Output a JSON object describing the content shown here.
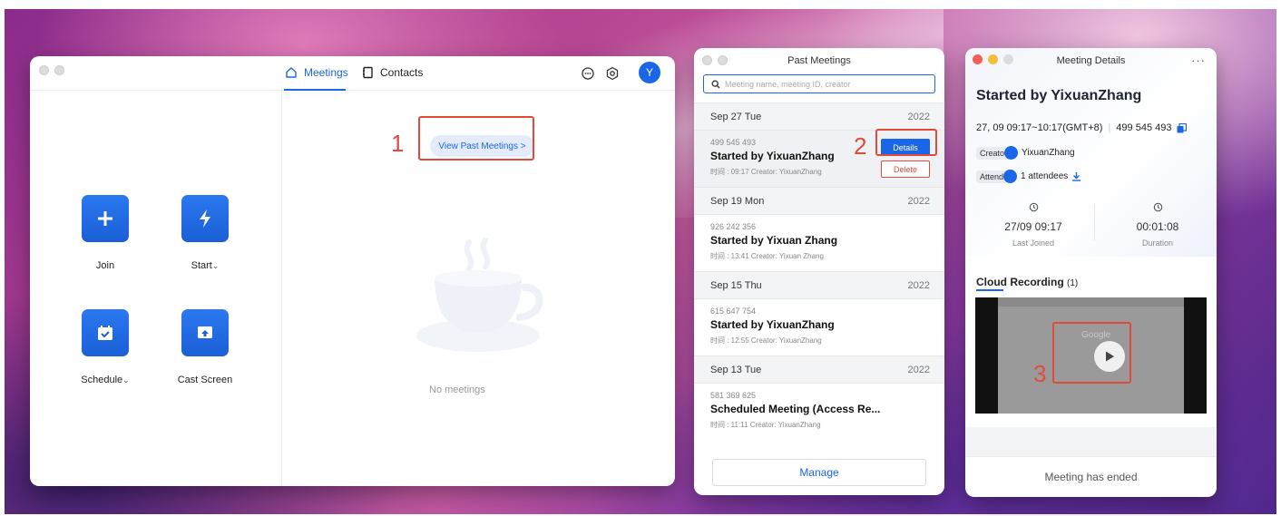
{
  "main_window": {
    "tabs": [
      {
        "label": "Meetings",
        "active": true
      },
      {
        "label": "Contacts",
        "active": false
      }
    ],
    "avatar_letter": "Y",
    "actions": [
      {
        "label": "Join",
        "icon": "plus-icon",
        "caret": false
      },
      {
        "label": "Start",
        "icon": "bolt-icon",
        "caret": true
      },
      {
        "label": "Schedule",
        "icon": "calendar-check-icon",
        "caret": true
      },
      {
        "label": "Cast Screen",
        "icon": "cast-screen-icon",
        "caret": false
      }
    ],
    "caret_glyph": "⌄",
    "view_past_label": "View Past Meetings >",
    "empty_text": "No meetings"
  },
  "annotations": {
    "step1": "1",
    "step2": "2",
    "step3": "3"
  },
  "past_meetings": {
    "title": "Past Meetings",
    "search_placeholder": "Meeting name, meeting ID, creator",
    "groups": [
      {
        "date": "Sep 27 Tue",
        "year": "2022",
        "meeting_id": "499 545 493",
        "title": "Started by YixuanZhang",
        "meta": "时间 : 09:17   Creator: YixuanZhang",
        "selected": true
      },
      {
        "date": "Sep 19 Mon",
        "year": "2022",
        "meeting_id": "926 242 356",
        "title": "Started by Yixuan Zhang",
        "meta": "时间 : 13:41   Creator: Yixuan Zhang",
        "selected": false
      },
      {
        "date": "Sep 15 Thu",
        "year": "2022",
        "meeting_id": "615 647 754",
        "title": "Started by YixuanZhang",
        "meta": "时间 : 12:55   Creator: YixuanZhang",
        "selected": false
      },
      {
        "date": "Sep 13 Tue",
        "year": "2022",
        "meeting_id": "581 369 625",
        "title": "Scheduled Meeting (Access Re...",
        "meta": "时间 : 11:11   Creator: YixuanZhang",
        "selected": false
      }
    ],
    "details_label": "Details",
    "delete_label": "Delete",
    "manage_label": "Manage"
  },
  "meeting_details": {
    "window_title": "Meeting Details",
    "more": "···",
    "title": "Started by YixuanZhang",
    "time_range": "27, 09 09:17~10:17(GMT+8)",
    "meeting_id": "499 545 493",
    "creator_chip": "Creato",
    "creator_name": "YixuanZhang",
    "attendee_chip": "Attend",
    "attendees_text": "1 attendees",
    "last_joined_value": "27/09 09:17",
    "last_joined_label": "Last Joined",
    "duration_value": "00:01:08",
    "duration_label": "Duration",
    "recording_title": "Cloud Recording",
    "recording_count": "(1)",
    "video_logo_text": "Google",
    "ended_text": "Meeting has ended"
  },
  "colors": {
    "accent": "#1a66e8",
    "annotation_red": "#e04b3c"
  }
}
